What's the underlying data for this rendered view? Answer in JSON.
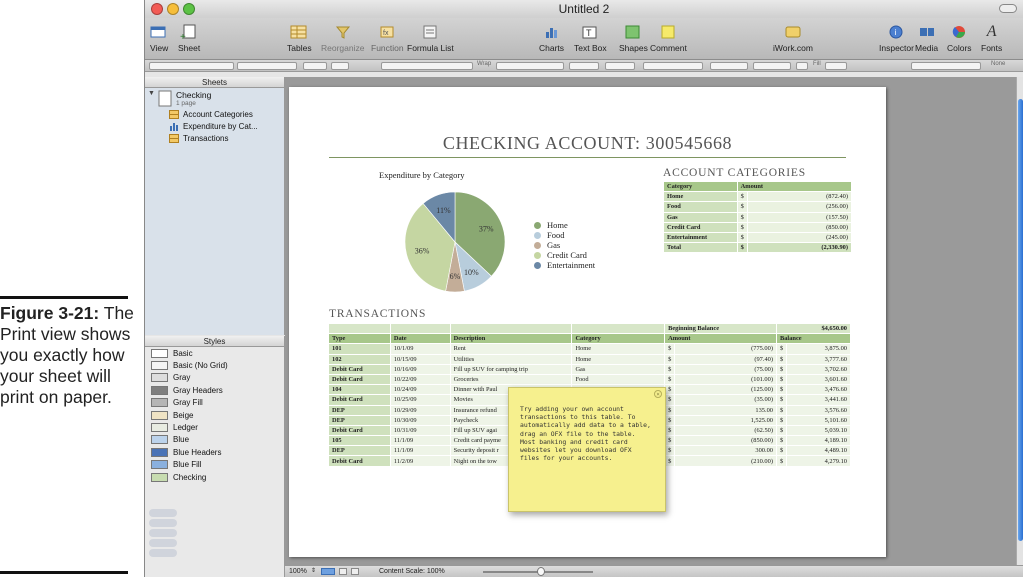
{
  "caption": {
    "figure": "Figure 3-21:",
    "text": "The Print view shows you exactly how your sheet will print on paper."
  },
  "window": {
    "title": "Untitled 2"
  },
  "toolbar": {
    "view": "View",
    "sheet": "Sheet",
    "tables": "Tables",
    "reorganize": "Reorganize",
    "function": "Function",
    "formula_list": "Formula List",
    "charts": "Charts",
    "text_box": "Text Box",
    "shapes": "Shapes",
    "comment": "Comment",
    "iwork": "iWork.com",
    "inspector": "Inspector",
    "media": "Media",
    "colors": "Colors",
    "fonts": "Fonts"
  },
  "format_bar": {
    "wrap": "Wrap",
    "fill": "Fill",
    "none": "None"
  },
  "sheets_pane": {
    "header": "Sheets",
    "sheet_name": "Checking",
    "sheet_pages": "1 page",
    "items": [
      "Account Categories",
      "Expenditure by Cat...",
      "Transactions"
    ]
  },
  "styles_pane": {
    "header": "Styles",
    "items": [
      {
        "label": "Basic",
        "color": "#ffffff"
      },
      {
        "label": "Basic (No Grid)",
        "color": "#f4f4f4"
      },
      {
        "label": "Gray",
        "color": "#dddddd"
      },
      {
        "label": "Gray Headers",
        "color": "#7f7f7f"
      },
      {
        "label": "Gray Fill",
        "color": "#b5b5b5"
      },
      {
        "label": "Beige",
        "color": "#efe3c4"
      },
      {
        "label": "Ledger",
        "color": "#e8ece2"
      },
      {
        "label": "Blue",
        "color": "#bcd3ec"
      },
      {
        "label": "Blue Headers",
        "color": "#4a73b6"
      },
      {
        "label": "Blue Fill",
        "color": "#8ab0de"
      },
      {
        "label": "Checking",
        "color": "#c7dcb0"
      }
    ]
  },
  "sheet": {
    "title": "CHECKING ACCOUNT: 300545668",
    "account_categories_title": "ACCOUNT CATEGORIES",
    "transactions_title": "TRANSACTIONS"
  },
  "chart_data": {
    "type": "pie",
    "title": "Expenditure by Category",
    "slices": [
      {
        "name": "Home",
        "value": 37,
        "label": "37%",
        "color": "#8aa872"
      },
      {
        "name": "Food",
        "value": 10,
        "label": "10%",
        "color": "#b8cddc"
      },
      {
        "name": "Gas",
        "value": 6,
        "label": "6%",
        "color": "#c3ad98"
      },
      {
        "name": "Credit Card",
        "value": 36,
        "label": "36%",
        "color": "#c5d6a2"
      },
      {
        "name": "Entertainment",
        "value": 11,
        "label": "11%",
        "color": "#6b88a6"
      }
    ]
  },
  "account_categories": {
    "headers": [
      "Category",
      "Amount"
    ],
    "rows": [
      [
        "Home",
        "$",
        "(872.40)"
      ],
      [
        "Food",
        "$",
        "(256.00)"
      ],
      [
        "Gas",
        "$",
        "(157.50)"
      ],
      [
        "Credit Card",
        "$",
        "(850.00)"
      ],
      [
        "Entertainment",
        "$",
        "(245.00)"
      ]
    ],
    "total": [
      "Total",
      "$",
      "(2,330.90)"
    ]
  },
  "transactions": {
    "beginning_balance_label": "Beginning Balance",
    "beginning_balance_value": "$4,650.00",
    "headers": [
      "Type",
      "Date",
      "Description",
      "Category",
      "Amount",
      "Balance"
    ],
    "rows": [
      [
        "101",
        "10/1/09",
        "Rent",
        "Home",
        "$",
        "(775.00)",
        "$",
        "3,875.00"
      ],
      [
        "102",
        "10/15/09",
        "Utilities",
        "Home",
        "$",
        "(97.40)",
        "$",
        "3,777.60"
      ],
      [
        "Debit Card",
        "10/16/09",
        "Fill up SUV for camping trip",
        "Gas",
        "$",
        "(75.00)",
        "$",
        "3,702.60"
      ],
      [
        "Debit Card",
        "10/22/09",
        "Groceries",
        "Food",
        "$",
        "(101.00)",
        "$",
        "3,601.60"
      ],
      [
        "104",
        "10/24/09",
        "Dinner with Paul",
        "",
        "$",
        "(125.00)",
        "$",
        "3,476.60"
      ],
      [
        "Debit Card",
        "10/25/09",
        "Movies",
        "",
        "$",
        "(35.00)",
        "$",
        "3,441.60"
      ],
      [
        "DEP",
        "10/29/09",
        "Insurance refund",
        "",
        "$",
        "135.00",
        "$",
        "3,576.60"
      ],
      [
        "DEP",
        "10/30/09",
        "Paycheck",
        "",
        "$",
        "1,525.00",
        "$",
        "5,101.60"
      ],
      [
        "Debit Card",
        "10/31/09",
        "Fill up SUV agai",
        "",
        "$",
        "(62.50)",
        "$",
        "5,039.10"
      ],
      [
        "105",
        "11/1/09",
        "Credit card payme",
        "",
        "$",
        "(850.00)",
        "$",
        "4,189.10"
      ],
      [
        "DEP",
        "11/1/09",
        "Security deposit r",
        "",
        "$",
        "300.00",
        "$",
        "4,489.10"
      ],
      [
        "Debit Card",
        "11/2/09",
        "Night on the tow",
        "",
        "$",
        "(210.00)",
        "$",
        "4,279.10"
      ]
    ]
  },
  "sticky_note": {
    "text": "Try adding your own account transactions to this table. To automatically add data to a table, drag an OFX file to the table. Most banking and credit card websites let you download OFX files for your accounts."
  },
  "bottom_bar": {
    "zoom": "100%",
    "content_scale": "Content Scale: 100%"
  }
}
